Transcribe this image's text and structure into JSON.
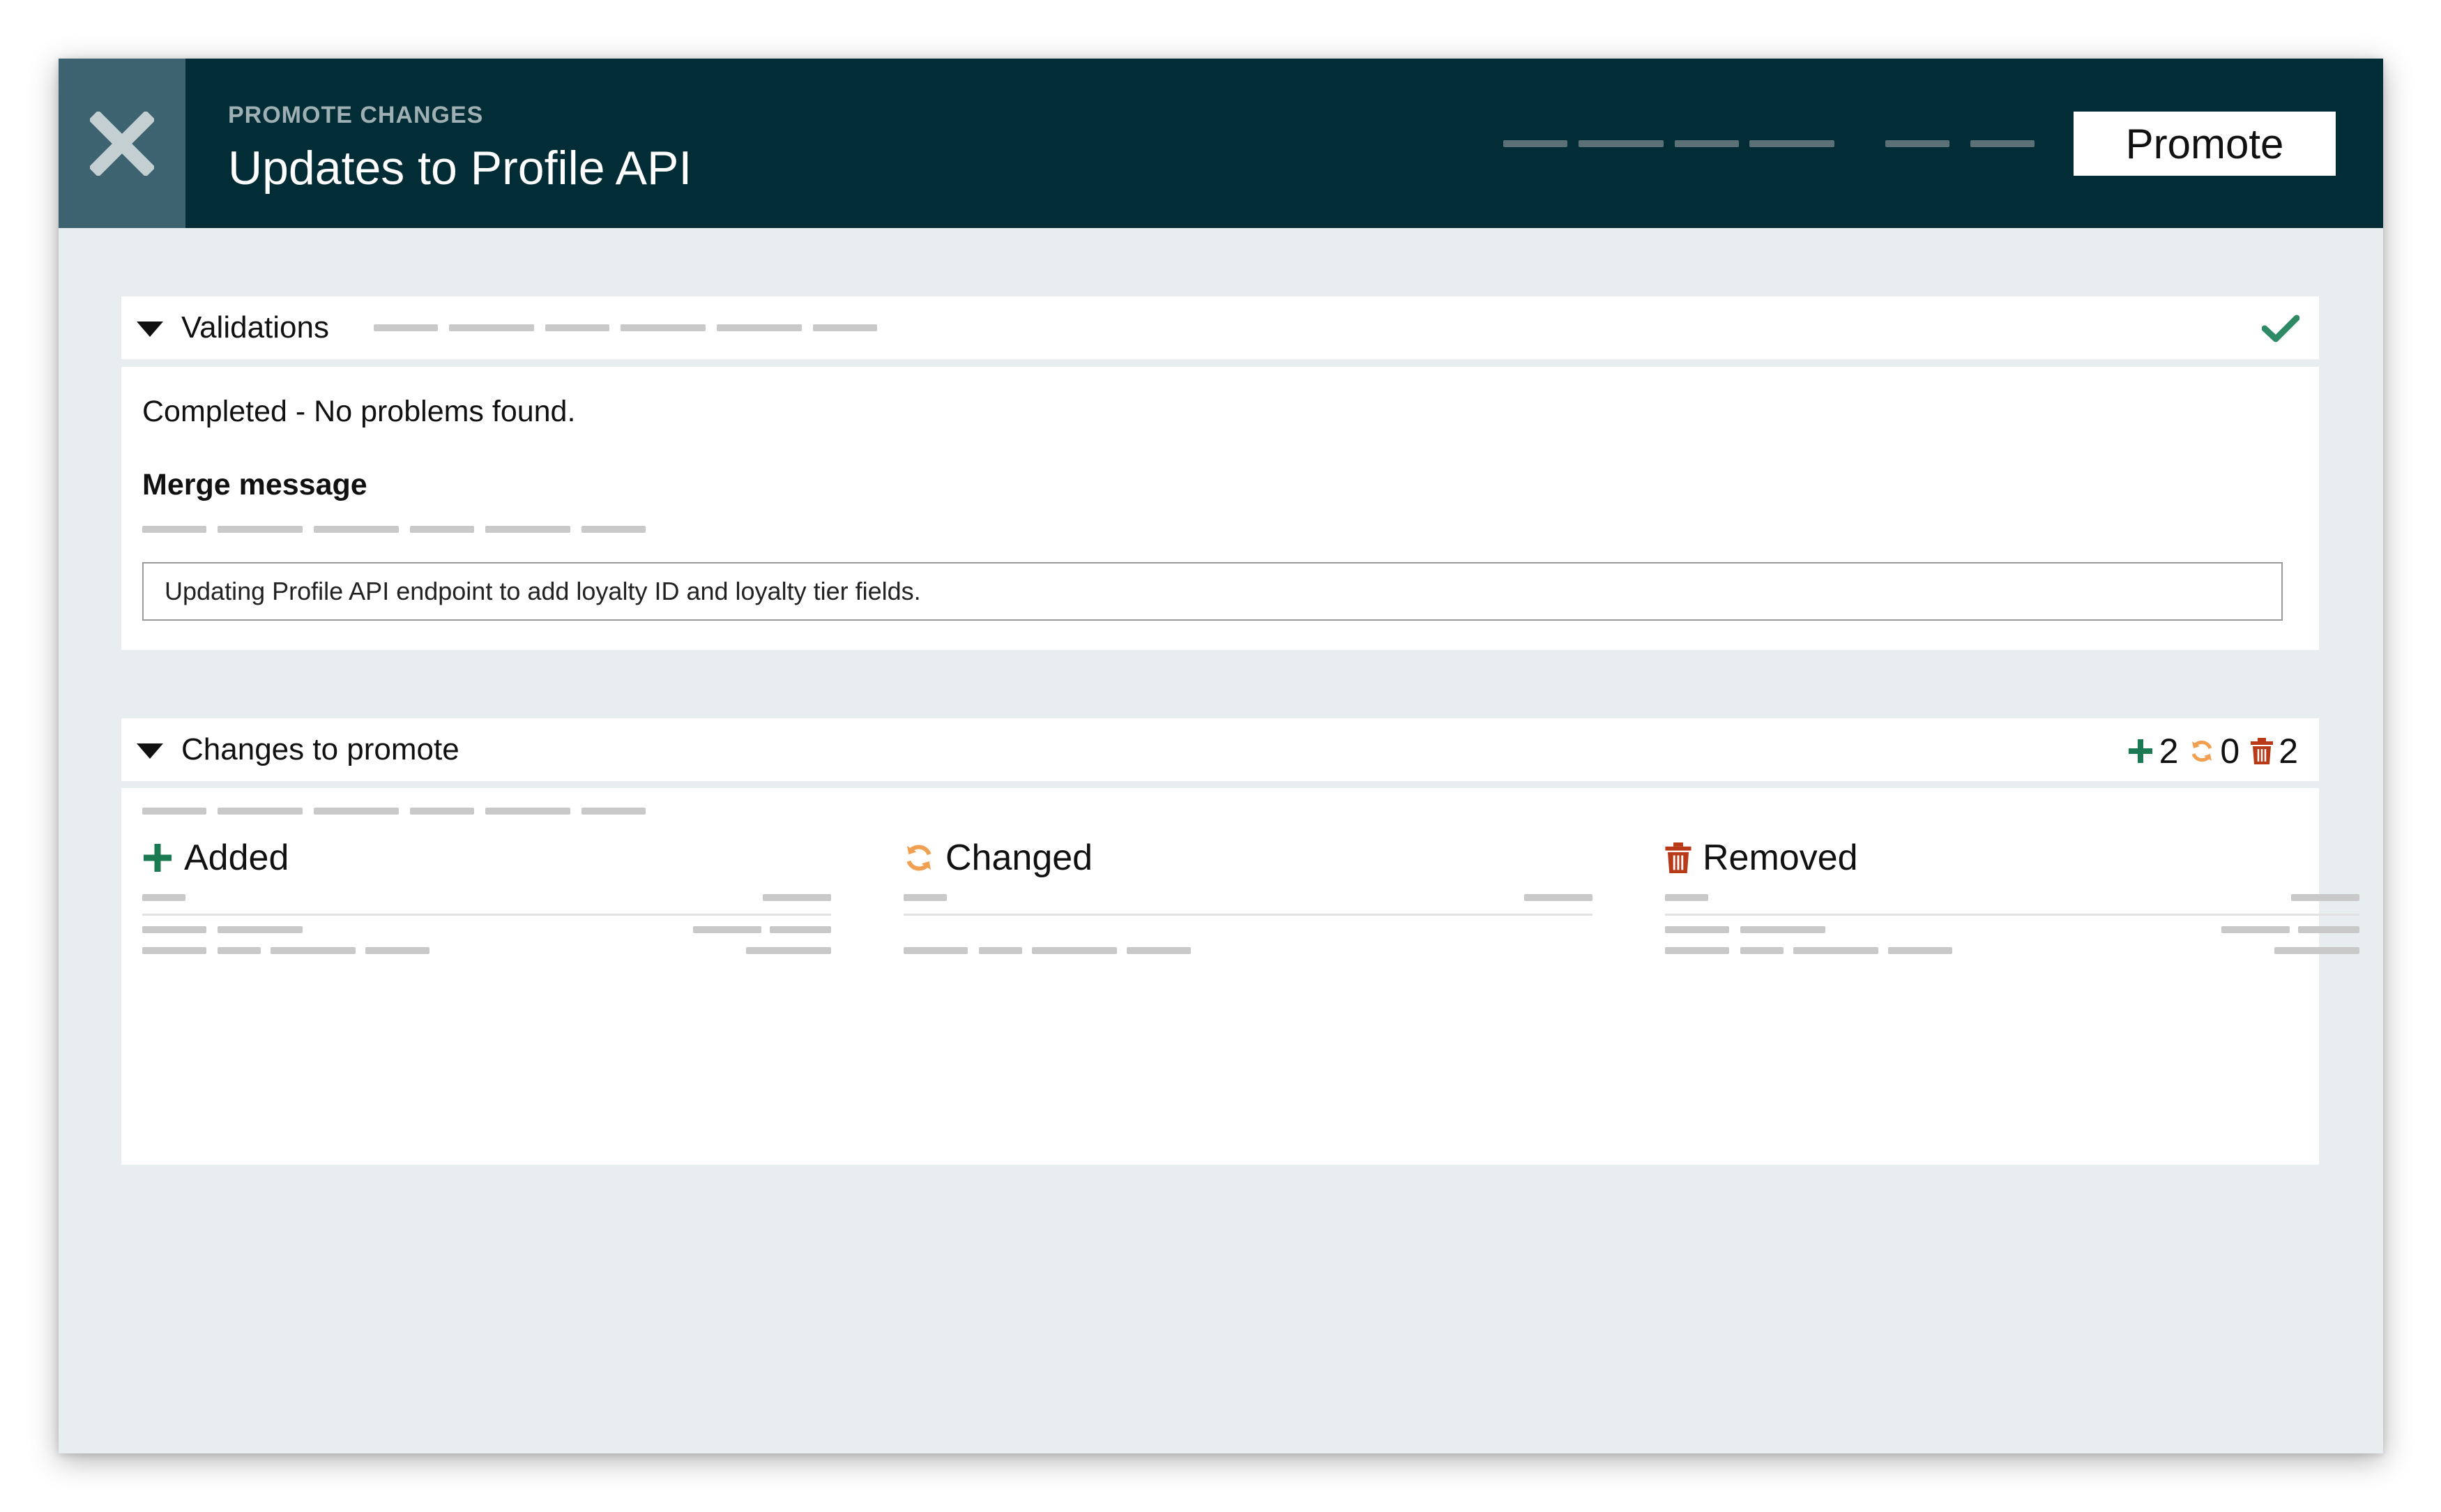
{
  "header": {
    "eyebrow": "PROMOTE CHANGES",
    "title": "Updates to Profile API",
    "promote_label": "Promote"
  },
  "validations": {
    "title": "Validations",
    "status": "Completed - No problems found.",
    "merge_label": "Merge message",
    "merge_value": "Updating Profile API endpoint to add loyalty ID and loyalty tier fields."
  },
  "changes": {
    "title": "Changes to promote",
    "counts": {
      "added": "2",
      "changed": "0",
      "removed": "2"
    },
    "columns": {
      "added": "Added",
      "changed": "Changed",
      "removed": "Removed"
    }
  },
  "colors": {
    "header_bg": "#032d36",
    "close_bg": "#3d6370",
    "added": "#1a7a52",
    "changed": "#f0a050",
    "removed": "#b83a18",
    "check": "#2e8a64"
  },
  "icons": [
    "close-icon",
    "caret-down-icon",
    "check-icon",
    "plus-icon",
    "refresh-icon",
    "trash-icon"
  ]
}
